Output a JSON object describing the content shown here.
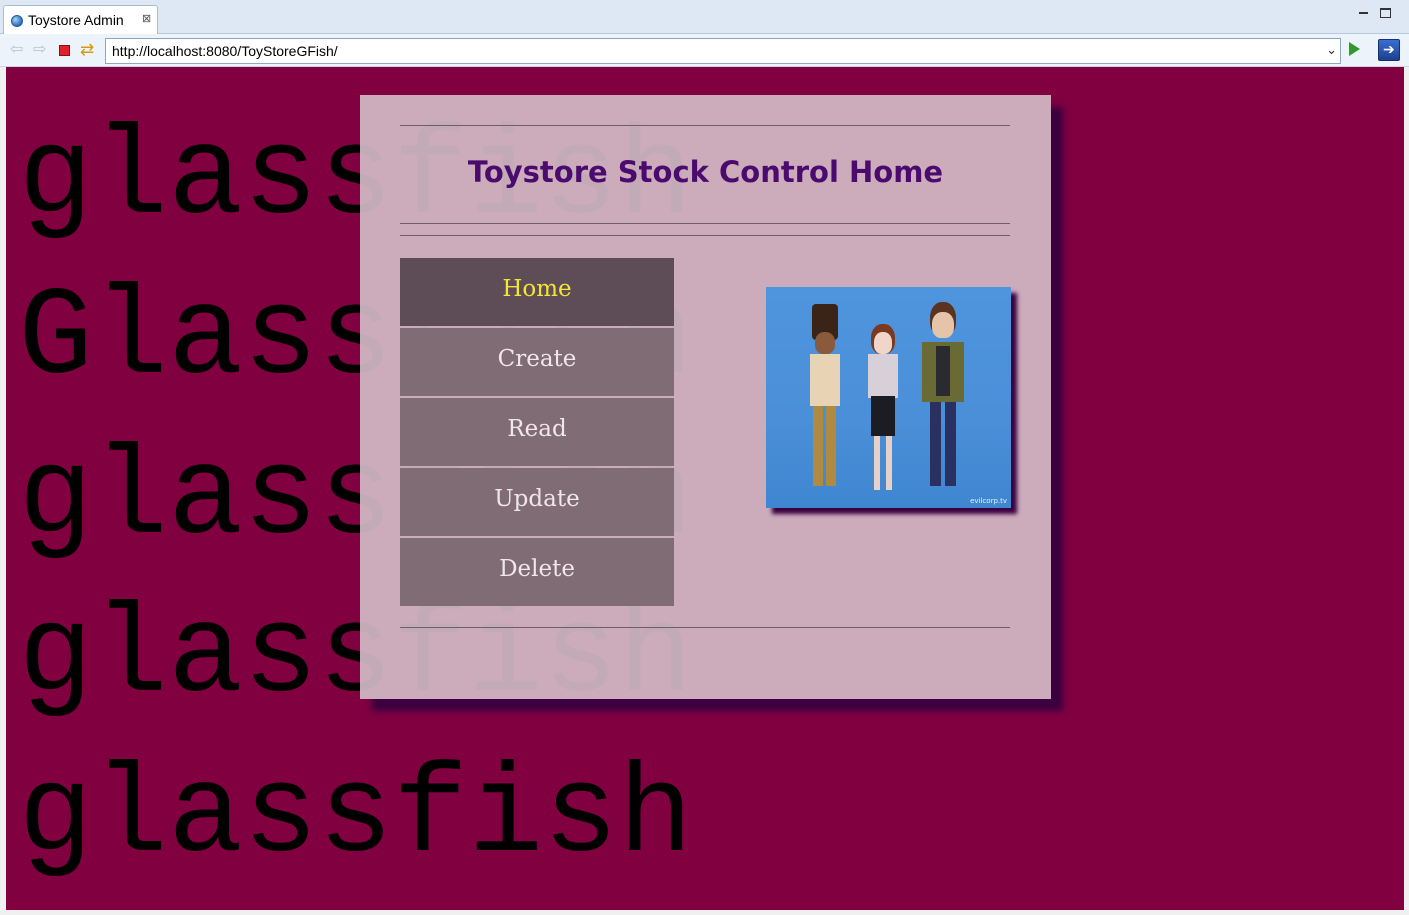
{
  "window": {
    "tab_title": "Toystore Admin",
    "tab_close": "⊠"
  },
  "toolbar": {
    "url": "http://localhost:8080/ToyStoreGFish/",
    "back_glyph": "⇦",
    "forward_glyph": "⇨",
    "refresh_glyph": "⇄",
    "dropdown_glyph": "⌄"
  },
  "background_words": [
    "glassfish",
    "Glassfish",
    "glassfish",
    "glassfish",
    "glassfish"
  ],
  "page": {
    "title": "Toystore Stock Control Home",
    "menu": [
      {
        "label": "Home",
        "active": true
      },
      {
        "label": "Create",
        "active": false
      },
      {
        "label": "Read",
        "active": false
      },
      {
        "label": "Update",
        "active": false
      },
      {
        "label": "Delete",
        "active": false
      }
    ],
    "photo_credit": "evilcorp.tv"
  },
  "colors": {
    "page_background": "#800040",
    "panel": "#d2bac6",
    "title": "#4a0a6e",
    "menu_item": "#7f6c75",
    "menu_active": "#5e4c56",
    "menu_active_text": "#f2e636"
  },
  "icons": [
    "globe-icon",
    "close-icon",
    "back-icon",
    "forward-icon",
    "stop-icon",
    "refresh-icon",
    "dropdown-icon",
    "go-icon",
    "external-browser-icon",
    "minimize-icon",
    "maximize-icon"
  ]
}
